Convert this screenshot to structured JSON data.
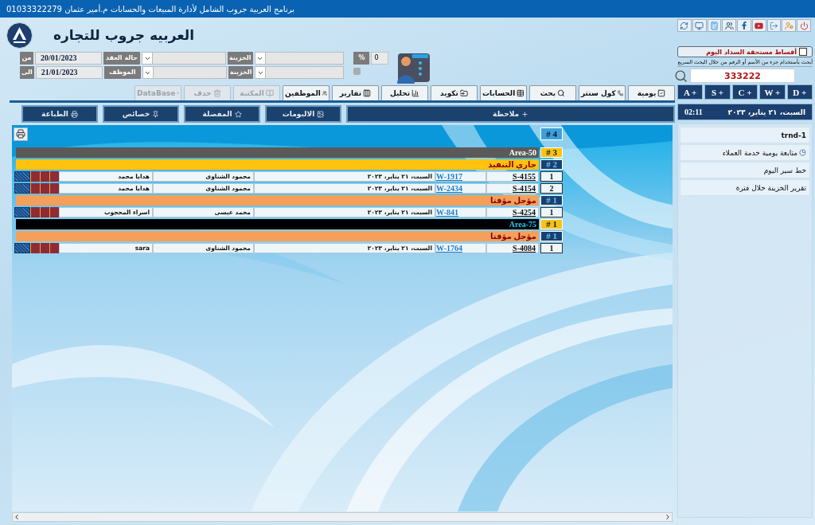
{
  "title_bar": {
    "title": "برنامج العربية جروب الشامل لأدارة المبيعات والحسابات م.أمير عثمان 01033322279"
  },
  "header": {
    "app_name": "العربيه جروب للتجاره"
  },
  "filters": {
    "rows": [
      {
        "date_label": "من",
        "date": "20/01/2023",
        "field_label": "حالة العقد",
        "treasury_label": "الخزينة"
      },
      {
        "date_label": "الى",
        "date": "21/01/2023",
        "field_label": "الموظف",
        "treasury_label": "الخزينة"
      }
    ],
    "percent_label": "%",
    "percent_value": "0"
  },
  "quick": {
    "installments": {
      "label": "أقساط مستحقة السداد اليوم",
      "checked": false
    },
    "hint": "أبحث بأستخدام جزء من الأسم أو الرقم من خلال البحث السريع",
    "search_value": "333222"
  },
  "shortcuts": [
    "D +",
    "W +",
    "C +",
    "S +",
    "A +"
  ],
  "toolbar": [
    {
      "label": "يومية",
      "disabled": false
    },
    {
      "label": "كول سنتر",
      "disabled": false
    },
    {
      "label": "بحث",
      "disabled": false
    },
    {
      "label": "الحسابات",
      "disabled": false
    },
    {
      "label": "تكويد",
      "disabled": false
    },
    {
      "label": "تحليل",
      "disabled": false
    },
    {
      "label": "تقارير",
      "disabled": false
    },
    {
      "label": "الموظفين",
      "disabled": false
    },
    {
      "label": "المكتبة",
      "disabled": true
    },
    {
      "label": "حذف",
      "disabled": true
    },
    {
      "label": "DataBase",
      "disabled": true
    }
  ],
  "actions": [
    "ملاحظة",
    "الالبومات",
    "المفضلة",
    "خصائص",
    "الطباعة"
  ],
  "datetime": {
    "date": "السبت، ٢١ يناير، ٢٠٢٣",
    "time": "02:11"
  },
  "side_panel": {
    "items": [
      "trnd-1",
      "متابعة يومية خدمة العملاء",
      "خط سير اليوم",
      "تقرير الخزينة  خلال فترة"
    ]
  },
  "list": {
    "total": "# 4",
    "rows": [
      {
        "kind": "area",
        "count": "# 3",
        "label": "Area-50",
        "color": "#5a5a5a"
      },
      {
        "kind": "status",
        "count": "# 2",
        "label": "جاري التنفيذ",
        "color": "#ffc20e"
      },
      {
        "kind": "record",
        "number": "1",
        "code": "S-4155",
        "ref": "W-1917",
        "date": "السبت، ٢١ يناير، ٢٠٢٣",
        "employee": "محمود الشناوى",
        "client": "هدايا محمد"
      },
      {
        "kind": "record",
        "number": "2",
        "code": "S-4154",
        "ref": "W-2434",
        "date": "السبت، ٢١ يناير، ٢٠٢٣",
        "employee": "محمود الشناوى",
        "client": "هدايا محمد"
      },
      {
        "kind": "status",
        "count": "# 1",
        "label": "مؤجل مؤقتا",
        "color": "#f4a05a"
      },
      {
        "kind": "record",
        "number": "1",
        "code": "S-4254",
        "ref": "W-841",
        "date": "السبت، ٢١ يناير، ٢٠٢٣",
        "employee": "محمد عيسى",
        "client": "اسراء المحجوب"
      },
      {
        "kind": "area",
        "count": "# 1",
        "label": "Area-75",
        "color": "#000000"
      },
      {
        "kind": "status",
        "count": "# 1",
        "label": "مؤجل مؤقتا",
        "color": "#f4a05a"
      },
      {
        "kind": "record",
        "number": "1",
        "code": "S-4084",
        "ref": "W-1764",
        "date": "السبت، ٢١ يناير، ٢٠٢٣",
        "employee": "محمود الشناوى",
        "client": "sara"
      }
    ]
  }
}
